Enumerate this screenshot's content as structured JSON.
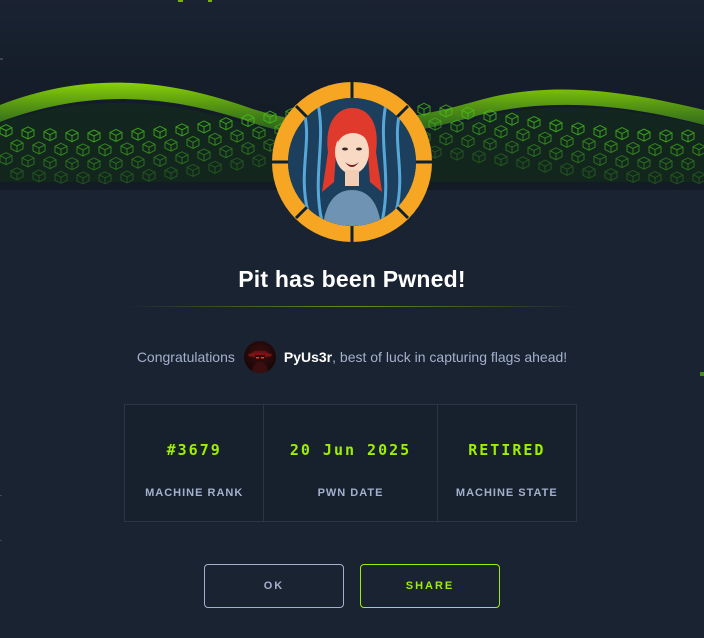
{
  "modal": {
    "title": "Pit has been Pwned!",
    "congrats_prefix": "Congratulations",
    "username": "PyUs3r",
    "congrats_suffix": ", best of luck in capturing flags ahead!"
  },
  "stats": [
    {
      "value": "#3679",
      "label": "MACHINE RANK"
    },
    {
      "value": "20 Jun 2025",
      "label": "PWN DATE"
    },
    {
      "value": "RETIRED",
      "label": "MACHINE STATE"
    }
  ],
  "buttons": {
    "ok": "OK",
    "share": "SHARE"
  },
  "icons": {
    "machine_avatar": "machine-avatar-icon",
    "user_avatar": "user-avatar-icon"
  },
  "colors": {
    "background": "#1a2332",
    "accent_green": "#9fef00",
    "machine_ring": "#f6a623",
    "muted_text": "#a4b1cd"
  }
}
